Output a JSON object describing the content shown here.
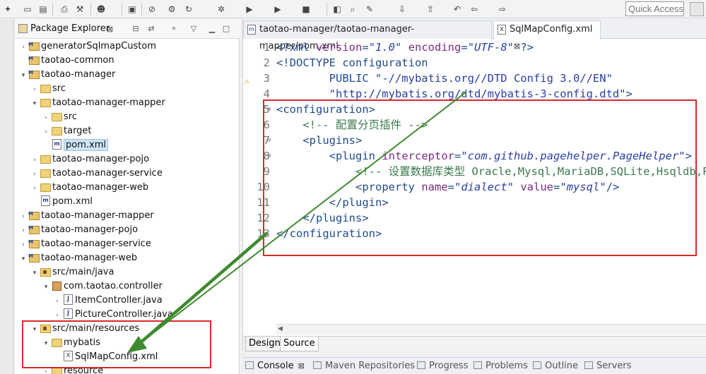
{
  "toolbar": {
    "quick_access_placeholder": "Quick Access",
    "icons": [
      "new-icon",
      "save-icon",
      "save-all-icon",
      "print-icon",
      "build-icon",
      "debug-user-icon",
      "open-console-icon",
      "skip-breakpoints-icon",
      "external-tools-icon",
      "refresh-icon",
      "debug-icon",
      "run-icon",
      "run-server-icon",
      "stop-icon",
      "open-type-icon",
      "search-icon",
      "next-annotation-icon",
      "prev-annotation-icon",
      "back-icon",
      "forward-icon"
    ]
  },
  "explorer": {
    "title": "Package Explorer",
    "close": "⊠",
    "tree": [
      {
        "label": "generatorSqlmapCustom",
        "level": 0,
        "icon": "project",
        "twisty": "collapsed"
      },
      {
        "label": "taotao-common",
        "level": 0,
        "icon": "project",
        "twisty": "none"
      },
      {
        "label": "taotao-manager",
        "level": 0,
        "icon": "project",
        "twisty": "expanded"
      },
      {
        "label": "src",
        "level": 1,
        "icon": "folder",
        "twisty": "collapsed"
      },
      {
        "label": "taotao-manager-mapper",
        "level": 1,
        "icon": "folder",
        "twisty": "expanded"
      },
      {
        "label": "src",
        "level": 2,
        "icon": "folder",
        "twisty": "collapsed"
      },
      {
        "label": "target",
        "level": 2,
        "icon": "folder",
        "twisty": "collapsed"
      },
      {
        "label": "pom.xml",
        "level": 2,
        "icon": "pom",
        "twisty": "none",
        "selected": true
      },
      {
        "label": "taotao-manager-pojo",
        "level": 1,
        "icon": "folder",
        "twisty": "collapsed"
      },
      {
        "label": "taotao-manager-service",
        "level": 1,
        "icon": "folder",
        "twisty": "collapsed"
      },
      {
        "label": "taotao-manager-web",
        "level": 1,
        "icon": "folder",
        "twisty": "collapsed"
      },
      {
        "label": "pom.xml",
        "level": 1,
        "icon": "pom",
        "twisty": "none"
      },
      {
        "label": "taotao-manager-mapper",
        "level": 0,
        "icon": "project",
        "twisty": "collapsed"
      },
      {
        "label": "taotao-manager-pojo",
        "level": 0,
        "icon": "project",
        "twisty": "collapsed"
      },
      {
        "label": "taotao-manager-service",
        "level": 0,
        "icon": "project",
        "twisty": "collapsed"
      },
      {
        "label": "taotao-manager-web",
        "level": 0,
        "icon": "project",
        "twisty": "expanded"
      },
      {
        "label": "src/main/java",
        "level": 1,
        "icon": "srcfolder",
        "twisty": "expanded"
      },
      {
        "label": "com.taotao.controller",
        "level": 2,
        "icon": "package",
        "twisty": "expanded"
      },
      {
        "label": "ItemController.java",
        "level": 3,
        "icon": "java",
        "twisty": "collapsed"
      },
      {
        "label": "PictureController.java",
        "level": 3,
        "icon": "java",
        "twisty": "collapsed"
      },
      {
        "label": "src/main/resources",
        "level": 1,
        "icon": "srcfolder",
        "twisty": "expanded"
      },
      {
        "label": "mybatis",
        "level": 2,
        "icon": "folder",
        "twisty": "expanded"
      },
      {
        "label": "SqlMapConfig.xml",
        "level": 3,
        "icon": "xml",
        "twisty": "none"
      },
      {
        "label": "resource",
        "level": 2,
        "icon": "folder",
        "twisty": "collapsed"
      }
    ]
  },
  "editor": {
    "tabs": [
      {
        "label": "taotao-manager/taotao-manager-mapper/pom.xml",
        "active": false,
        "icon": "m"
      },
      {
        "label": "SqlMapConfig.xml",
        "active": true,
        "icon": "X",
        "close": "⊠"
      }
    ],
    "lines": [
      {
        "n": "1",
        "fold": "",
        "tokens": [
          [
            "br",
            "<?"
          ],
          [
            "tag",
            "xml "
          ],
          [
            "attr",
            "version"
          ],
          [
            "br",
            "="
          ],
          [
            "val",
            "\"1.0\""
          ],
          [
            "br",
            " "
          ],
          [
            "attr",
            "encoding"
          ],
          [
            "br",
            "="
          ],
          [
            "val",
            "\"UTF-8\""
          ],
          [
            "br",
            " ?>"
          ]
        ]
      },
      {
        "n": "2",
        "fold": "",
        "tokens": [
          [
            "doc",
            "<!DOCTYPE configuration"
          ]
        ]
      },
      {
        "n": "3",
        "fold": "",
        "tokens": [
          [
            "doc",
            "        PUBLIC "
          ],
          [
            "str",
            "\"-//mybatis.org//DTD Config 3.0//EN\""
          ]
        ]
      },
      {
        "n": "4",
        "fold": "",
        "tokens": [
          [
            "str",
            "        \"http://mybatis.org/dtd/mybatis-3-config.dtd\""
          ],
          [
            "br",
            ">"
          ]
        ]
      },
      {
        "n": "5",
        "fold": "⊖",
        "tokens": [
          [
            "br",
            "<"
          ],
          [
            "tag",
            "configuration"
          ],
          [
            "br",
            ">"
          ]
        ]
      },
      {
        "n": "6",
        "fold": "",
        "tokens": [
          [
            "com",
            "    <!-- 配置分页插件 -->"
          ]
        ]
      },
      {
        "n": "7",
        "fold": "⊖",
        "tokens": [
          [
            "br",
            "    <"
          ],
          [
            "tag",
            "plugins"
          ],
          [
            "br",
            ">"
          ]
        ]
      },
      {
        "n": "8",
        "fold": "⊖",
        "tokens": [
          [
            "br",
            "        <"
          ],
          [
            "tag",
            "plugin "
          ],
          [
            "attr",
            "interceptor"
          ],
          [
            "br",
            "="
          ],
          [
            "val",
            "\"com.github.pagehelper.PageHelper\""
          ],
          [
            "br",
            ">"
          ]
        ]
      },
      {
        "n": "9",
        "fold": "",
        "tokens": [
          [
            "com",
            "            <!-- 设置数据库类型 Oracle,Mysql,MariaDB,SQLite,Hsqldb,PostgreSQL六种数据库-->"
          ]
        ]
      },
      {
        "n": "10",
        "fold": "",
        "tokens": [
          [
            "br",
            "            <"
          ],
          [
            "tag",
            "property "
          ],
          [
            "attr",
            "name"
          ],
          [
            "br",
            "="
          ],
          [
            "val",
            "\"dialect\""
          ],
          [
            "br",
            " "
          ],
          [
            "attr",
            "value"
          ],
          [
            "br",
            "="
          ],
          [
            "val",
            "\"mysql\""
          ],
          [
            "br",
            "/>"
          ]
        ]
      },
      {
        "n": "11",
        "fold": "",
        "tokens": [
          [
            "br",
            "        </"
          ],
          [
            "tag",
            "plugin"
          ],
          [
            "br",
            ">"
          ]
        ]
      },
      {
        "n": "12",
        "fold": "",
        "tokens": [
          [
            "br",
            "    </"
          ],
          [
            "tag",
            "plugins"
          ],
          [
            "br",
            ">"
          ]
        ]
      },
      {
        "n": "13",
        "fold": "",
        "tokens": [
          [
            "br",
            "</"
          ],
          [
            "tag",
            "configuration"
          ],
          [
            "br",
            ">"
          ]
        ]
      }
    ],
    "bottom_tabs": {
      "design": "Design",
      "source": "Source"
    }
  },
  "bottom_panel": {
    "tabs": [
      {
        "label": "Console",
        "active": true,
        "close": "⊠"
      },
      {
        "label": "Maven Repositories",
        "active": false
      },
      {
        "label": "Progress",
        "active": false
      },
      {
        "label": "Problems",
        "active": false
      },
      {
        "label": "Outline",
        "active": false
      },
      {
        "label": "Servers",
        "active": false
      }
    ]
  },
  "colors": {
    "highlight_box": "#d62b2b",
    "arrow": "#3f8a2f"
  }
}
